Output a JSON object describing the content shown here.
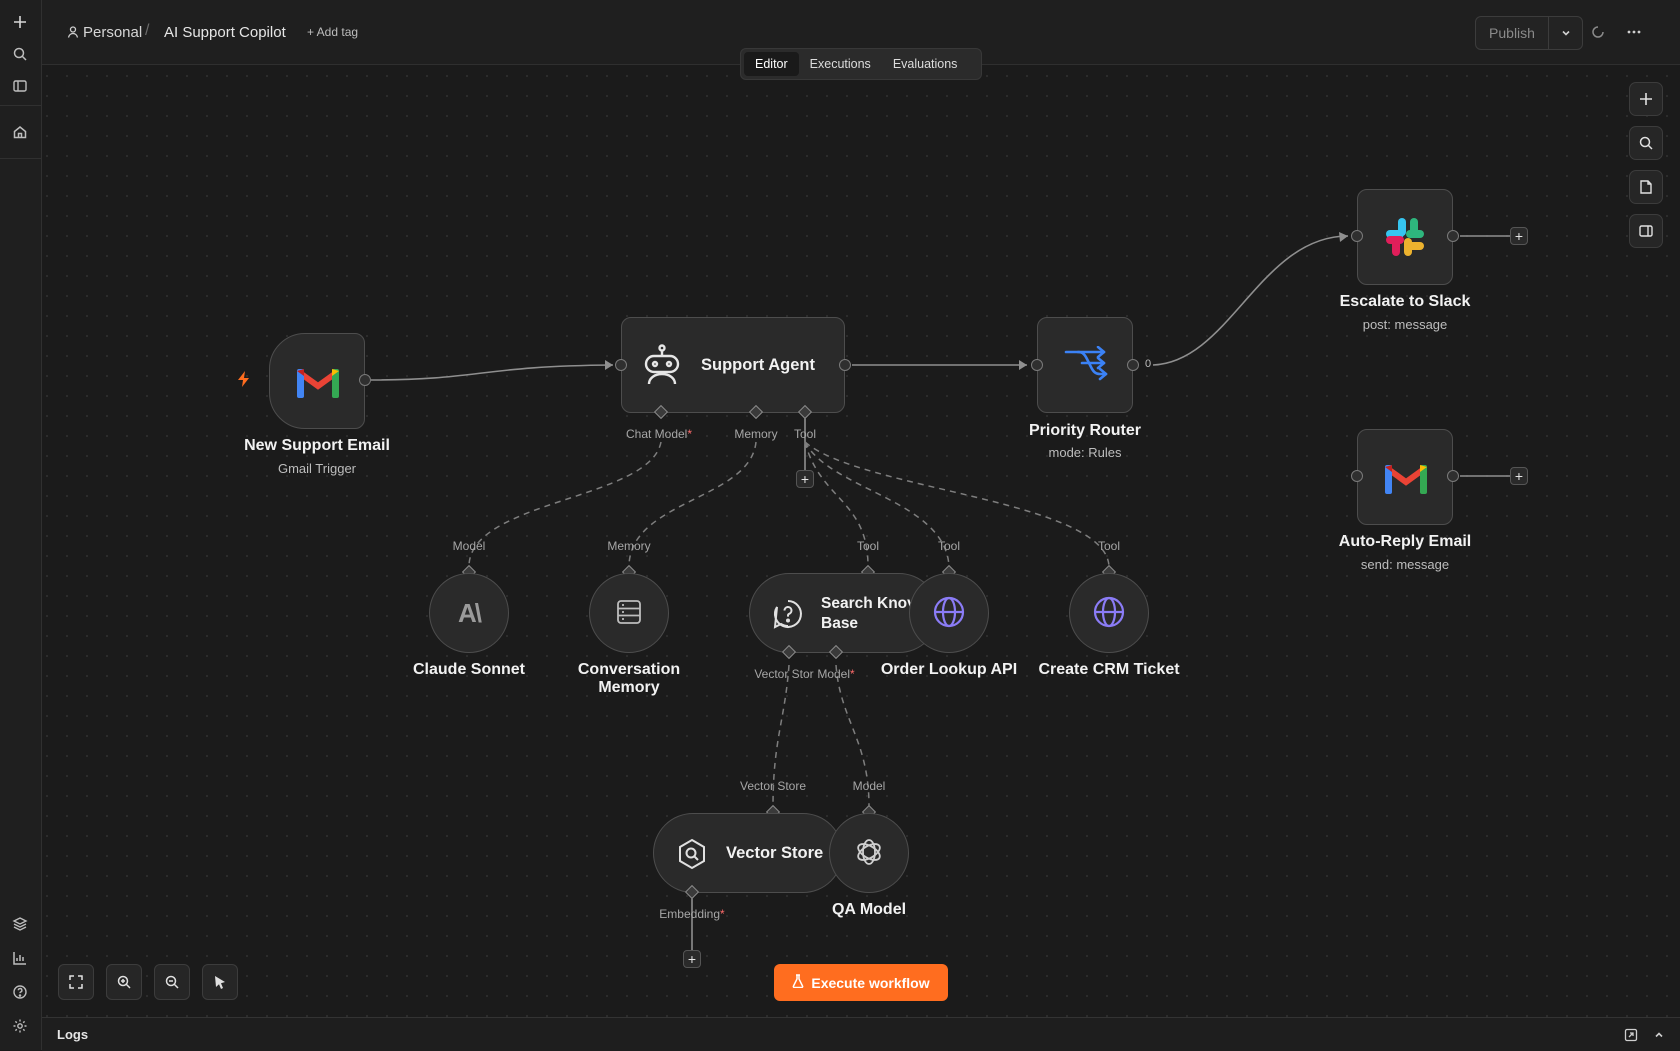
{
  "header": {
    "breadcrumb_owner": "Personal",
    "breadcrumb_separator": "/",
    "workflow_name": "AI Support Copilot",
    "add_tag_label": "+ Add tag",
    "publish_label": "Publish"
  },
  "tabs": [
    {
      "label": "Editor",
      "active": true
    },
    {
      "label": "Executions",
      "active": false
    },
    {
      "label": "Evaluations",
      "active": false
    }
  ],
  "nodes": {
    "trigger": {
      "title": "New Support Email",
      "subtitle": "Gmail Trigger",
      "icon": "gmail-icon"
    },
    "agent": {
      "title": "Support Agent",
      "icon": "robot-icon",
      "ports": {
        "chat_model": "Chat Model",
        "memory": "Memory",
        "tool": "Tool"
      }
    },
    "router": {
      "title": "Priority Router",
      "subtitle": "mode: Rules",
      "icon": "router-icon",
      "output_label": "0"
    },
    "slack": {
      "title": "Escalate to Slack",
      "subtitle": "post: message",
      "icon": "slack-icon"
    },
    "autoreply": {
      "title": "Auto-Reply Email",
      "subtitle": "send: message",
      "icon": "gmail-icon"
    },
    "claude": {
      "title": "Claude Sonnet",
      "port_label": "Model",
      "icon": "anthropic-icon"
    },
    "memory": {
      "title_line1": "Conversation",
      "title_line2": "Memory",
      "port_label": "Memory",
      "icon": "database-icon"
    },
    "search_kb": {
      "title_line1": "Search Knov",
      "title_line2": "Base",
      "port_label": "Tool",
      "icon": "question-icon",
      "ports": {
        "vector_store": "Vector Stor",
        "model": "Model"
      }
    },
    "order_api": {
      "title": "Order Lookup API",
      "port_label": "Tool",
      "icon": "globe-icon"
    },
    "crm": {
      "title": "Create CRM Ticket",
      "port_label": "Tool",
      "icon": "globe-icon"
    },
    "vector_store": {
      "title": "Vector Store",
      "port_label": "Vector Store",
      "icon": "vector-search-icon",
      "ports": {
        "embedding": "Embedding"
      }
    },
    "qa_model": {
      "title": "QA Model",
      "port_label": "Model",
      "icon": "openai-icon"
    }
  },
  "required_marker": "*",
  "execute_label": "Execute workflow",
  "logs_label": "Logs",
  "colors": {
    "accent": "#ff6d1f",
    "router_blue": "#3b82f6",
    "globe_purple": "#8b7cf6",
    "bolt": "#ff6d1f"
  }
}
